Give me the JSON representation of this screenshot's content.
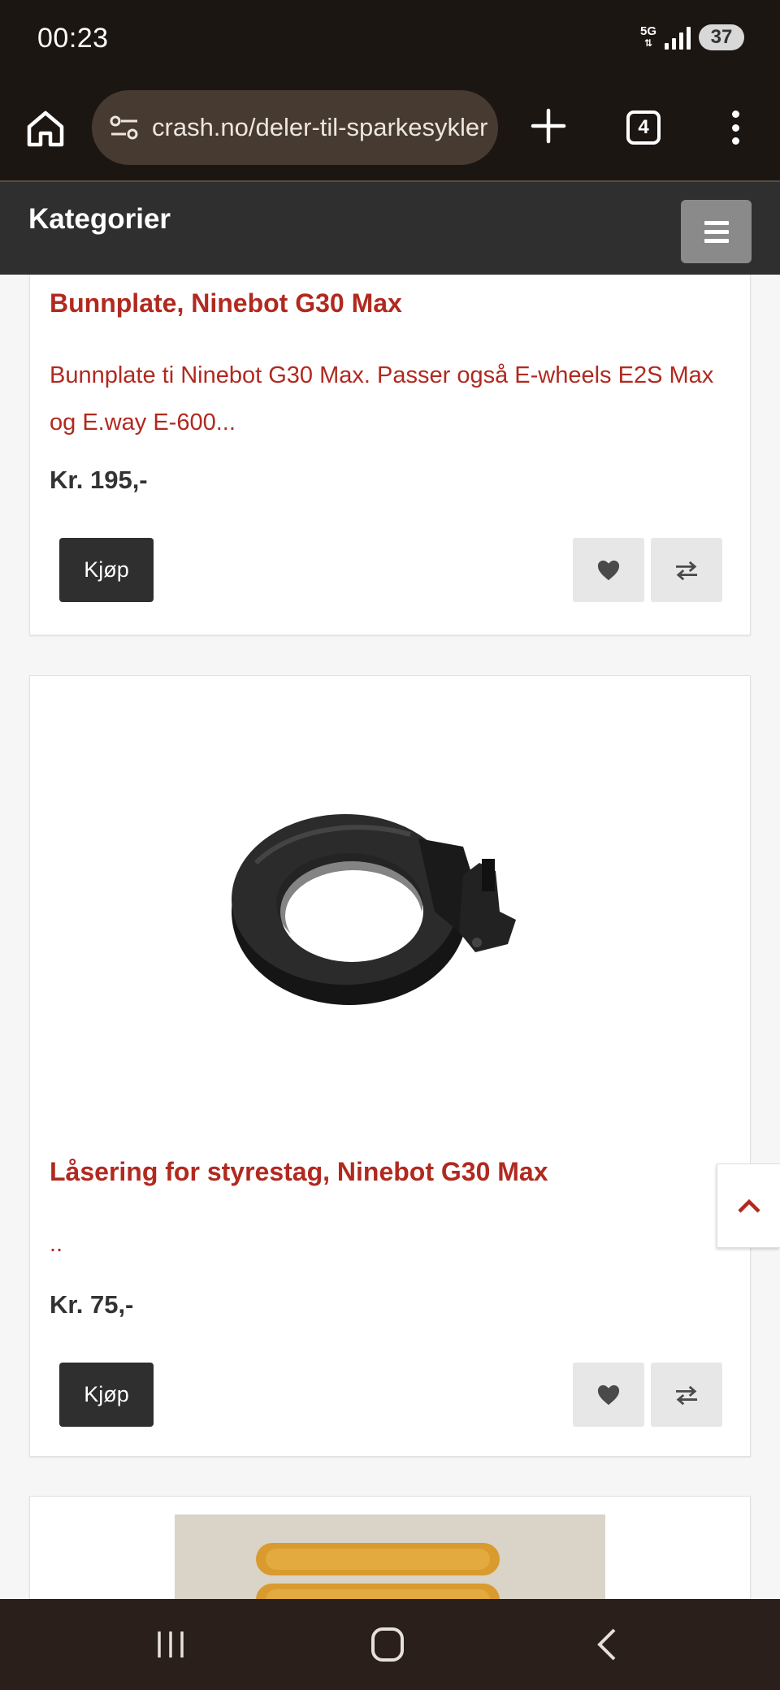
{
  "status": {
    "time": "00:23",
    "network": "5G",
    "battery": "37"
  },
  "browser": {
    "url": "crash.no/deler-til-sparkesykler",
    "tab_count": "4"
  },
  "header": {
    "title": "Kategorier"
  },
  "products": [
    {
      "title": "Bunnplate, Ninebot G30 Max",
      "description": "Bunnplate ti Ninebot G30 Max. Passer også E-wheels E2S Max og E.way E-600...",
      "price": "Kr. 195,-",
      "buy_label": "Kjøp"
    },
    {
      "title": "Låsering for styrestag, Ninebot G30 Max",
      "description": "..",
      "price": "Kr. 75,-",
      "buy_label": "Kjøp"
    }
  ],
  "colors": {
    "accent": "#b1291f",
    "dark": "#2f2f2f",
    "browser_bg": "#1c1613"
  },
  "icons": {
    "wishlist": "heart-icon",
    "compare": "compare-arrows-icon",
    "back_to_top": "chevron-up-icon"
  }
}
